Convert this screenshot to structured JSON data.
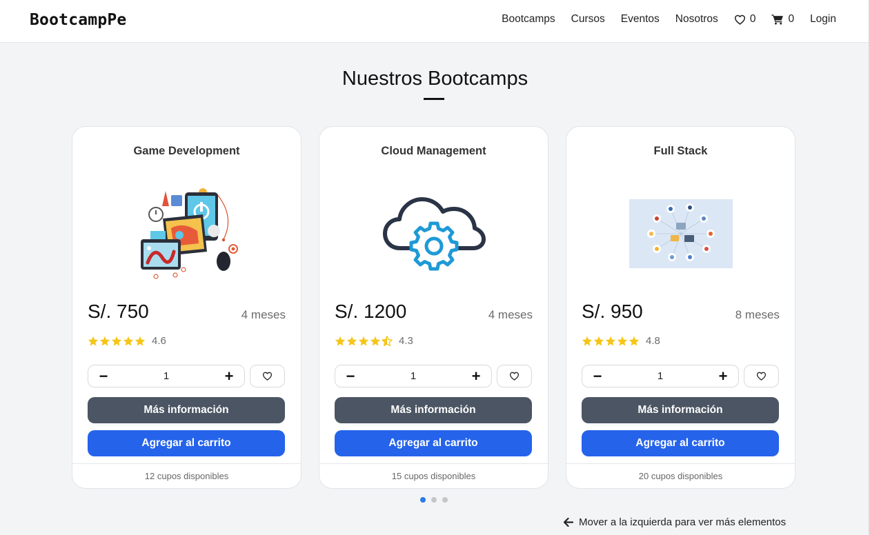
{
  "brand": "BootcampPe",
  "nav": {
    "links": [
      "Bootcamps",
      "Cursos",
      "Eventos",
      "Nosotros"
    ],
    "favorites_count": "0",
    "cart_count": "0",
    "login": "Login"
  },
  "section": {
    "title": "Nuestros Bootcamps"
  },
  "cards": [
    {
      "title": "Game Development",
      "price": "S/. 750",
      "duration": "4 meses",
      "rating": "4.6",
      "stars": 5,
      "quantity": "1",
      "info_label": "Más información",
      "cart_label": "Agregar al carrito",
      "availability": "12 cupos disponibles",
      "image_icon": "game-development-illustration"
    },
    {
      "title": "Cloud Management",
      "price": "S/. 1200",
      "duration": "4 meses",
      "rating": "4.3",
      "stars": 4.5,
      "quantity": "1",
      "info_label": "Más información",
      "cart_label": "Agregar al carrito",
      "availability": "15 cupos disponibles",
      "image_icon": "cloud-gear-icon"
    },
    {
      "title": "Full Stack",
      "price": "S/. 950",
      "duration": "8 meses",
      "rating": "4.8",
      "stars": 5,
      "quantity": "1",
      "info_label": "Más información",
      "cart_label": "Agregar al carrito",
      "availability": "20 cupos disponibles",
      "image_icon": "full-stack-diagram"
    }
  ],
  "carousel": {
    "pages": 3,
    "active_page": 1
  },
  "hint": "Mover a la izquierda para ver más elementos",
  "colors": {
    "primary": "#2563eb",
    "secondary": "#4b5563",
    "star": "#f5c518",
    "cloud_gear": "#1e9ad6",
    "cloud_outline": "#2a3446",
    "active_dot": "#2b7be4"
  }
}
